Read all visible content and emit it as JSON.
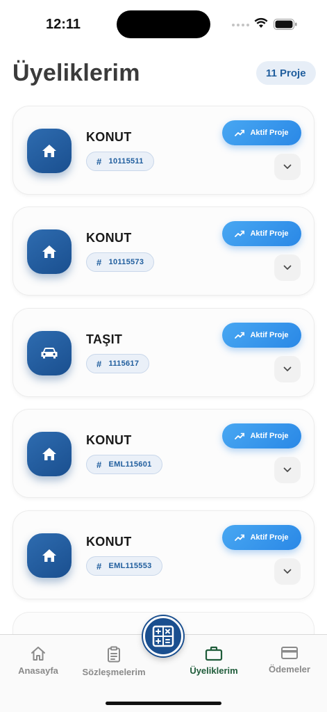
{
  "status_bar": {
    "time": "12:11"
  },
  "header": {
    "title": "Üyeliklerim",
    "count_badge": "11 Proje"
  },
  "cards": [
    {
      "title": "KONUT",
      "code": "10115511",
      "status": "Aktif Proje",
      "icon": "home-icon"
    },
    {
      "title": "KONUT",
      "code": "10115573",
      "status": "Aktif Proje",
      "icon": "home-icon"
    },
    {
      "title": "TAŞIT",
      "code": "1115617",
      "status": "Aktif Proje",
      "icon": "car-icon"
    },
    {
      "title": "KONUT",
      "code": "EML115601",
      "status": "Aktif Proje",
      "icon": "home-icon"
    },
    {
      "title": "KONUT",
      "code": "EML115553",
      "status": "Aktif Proje",
      "icon": "home-icon"
    }
  ],
  "tab_bar": {
    "tabs": [
      {
        "label": "Anasayfa",
        "icon": "home-icon",
        "active": false
      },
      {
        "label": "Sözleşmelerim",
        "icon": "clipboard-icon",
        "active": false
      },
      {
        "label": "Üyeliklerim",
        "icon": "briefcase-icon",
        "active": true
      },
      {
        "label": "Ödemeler",
        "icon": "credit-card-icon",
        "active": false
      }
    ],
    "center_button_icon": "calculator-icon"
  },
  "colors": {
    "brand_blue": "#1a4f8f",
    "accent_blue": "#2a88e6",
    "active_tab": "#1f5c3a",
    "inactive_tab": "#8a8a8a"
  }
}
